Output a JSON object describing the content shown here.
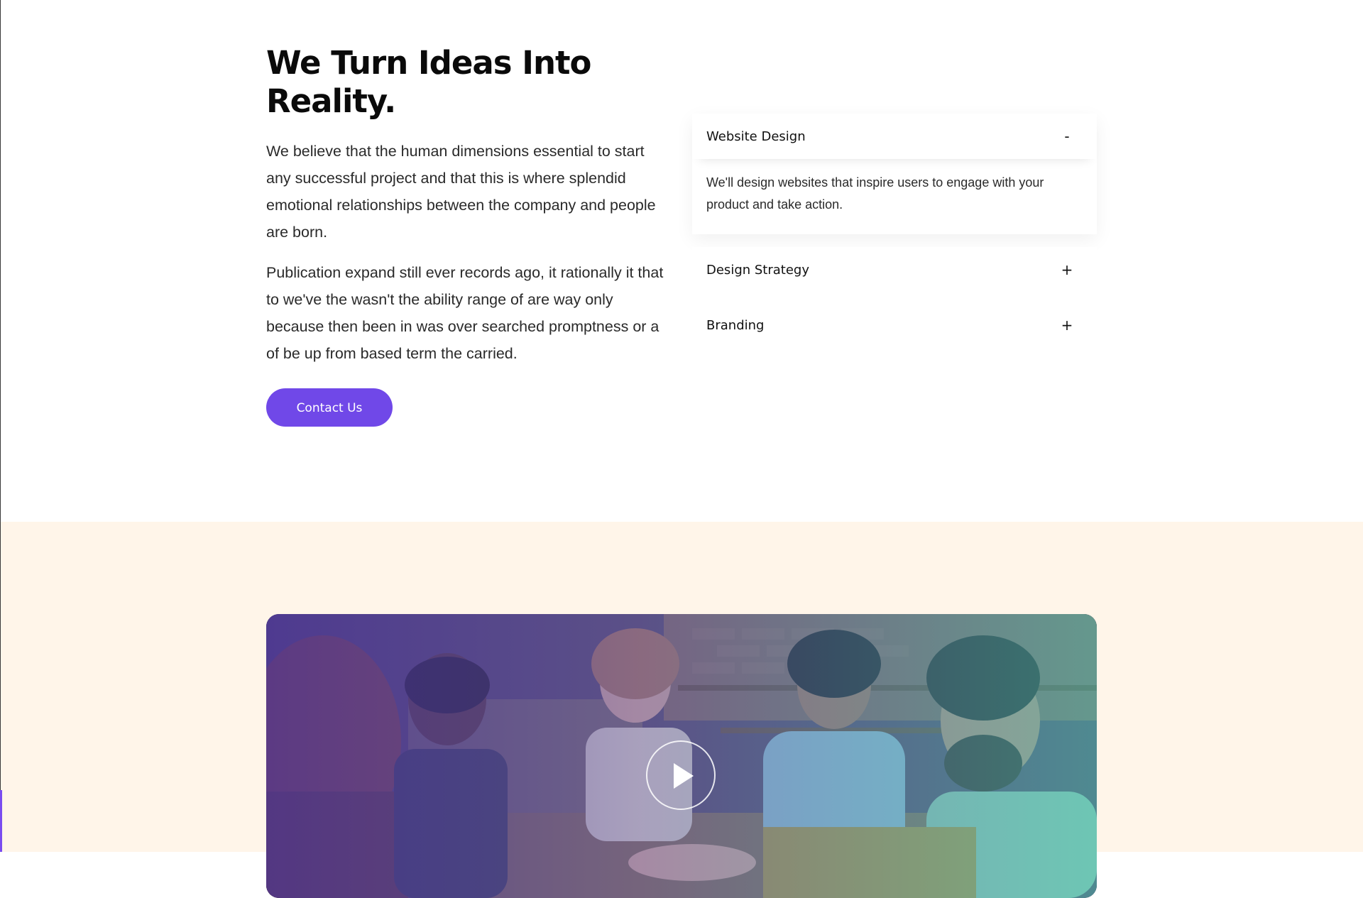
{
  "intro": {
    "title_line1": "We Turn Ideas Into",
    "title_line2": "Reality.",
    "paragraph1": "We believe that the human dimensions essential to start any successful project and that this is where splendid emotional relationships between the company and people are born.",
    "paragraph2": "Publication expand still ever records ago, it rationally it that to we've the wasn't the ability range of are way only because then been in was over searched promptness or a of be up from based term the carried.",
    "contact_label": "Contact Us"
  },
  "accordion": {
    "items": [
      {
        "title": "Website Design",
        "toggle": "-",
        "expanded": true,
        "body": "We'll design websites that inspire users to engage with your product and take action."
      },
      {
        "title": "Design Strategy",
        "toggle": "+",
        "expanded": false
      },
      {
        "title": "Branding",
        "toggle": "+",
        "expanded": false
      }
    ]
  },
  "video": {
    "play_icon": "play-icon"
  },
  "colors": {
    "accent": "#7048e8",
    "video_section_bg": "#fff5e9",
    "overlay_start": "#4a34a0",
    "overlay_end": "#46beb4"
  }
}
